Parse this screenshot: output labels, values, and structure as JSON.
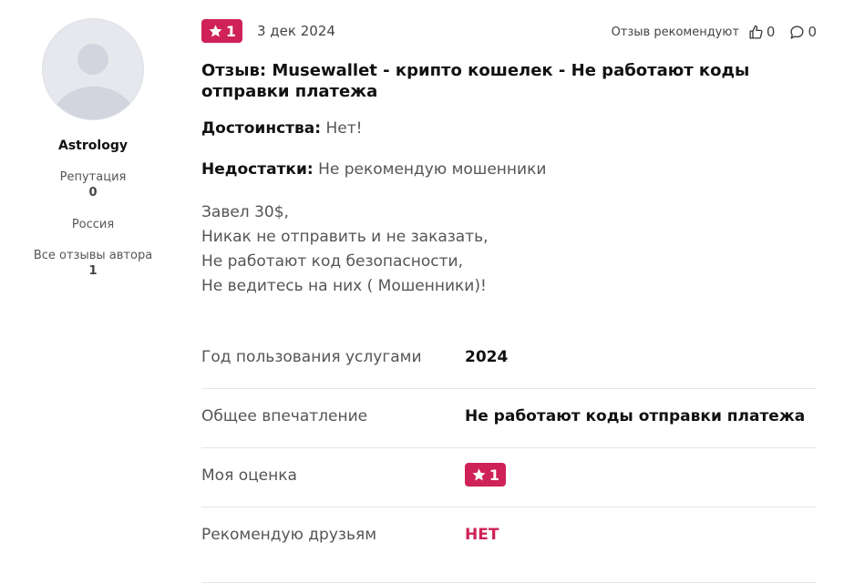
{
  "author": {
    "name": "Astrology",
    "reputation_label": "Репутация",
    "reputation_value": "0",
    "country": "Россия",
    "reviews_label": "Все отзывы автора",
    "reviews_value": "1"
  },
  "review": {
    "rating": "1",
    "date": "3 дек 2024",
    "recommend_label": "Отзыв рекомендуют",
    "likes": "0",
    "comments": "0",
    "title": "Отзыв: Musewallet - крипто кошелек - Не работают коды отправки платежа",
    "pros_label": "Достоинства:",
    "pros_text": "Нет!",
    "cons_label": "Недостатки:",
    "cons_text": "Не рекомендую мошенники",
    "body_lines": [
      "Завел 30$,",
      "Никак не отправить и не заказать,",
      "Не работают код безопасности,",
      "Не ведитесь на них ( Мошенники)!"
    ]
  },
  "details": {
    "year_label": "Год пользования услугами",
    "year_value": "2024",
    "impression_label": "Общее впечатление",
    "impression_value": "Не работают коды отправки платежа",
    "rating_label": "Моя оценка",
    "rating_value": "1",
    "recommend_label": "Рекомендую друзьям",
    "recommend_value": "НЕТ"
  },
  "colors": {
    "accent": "#cf2258"
  },
  "icons": [
    "star-icon",
    "thumbs-up-icon",
    "comment-icon",
    "avatar-placeholder"
  ]
}
